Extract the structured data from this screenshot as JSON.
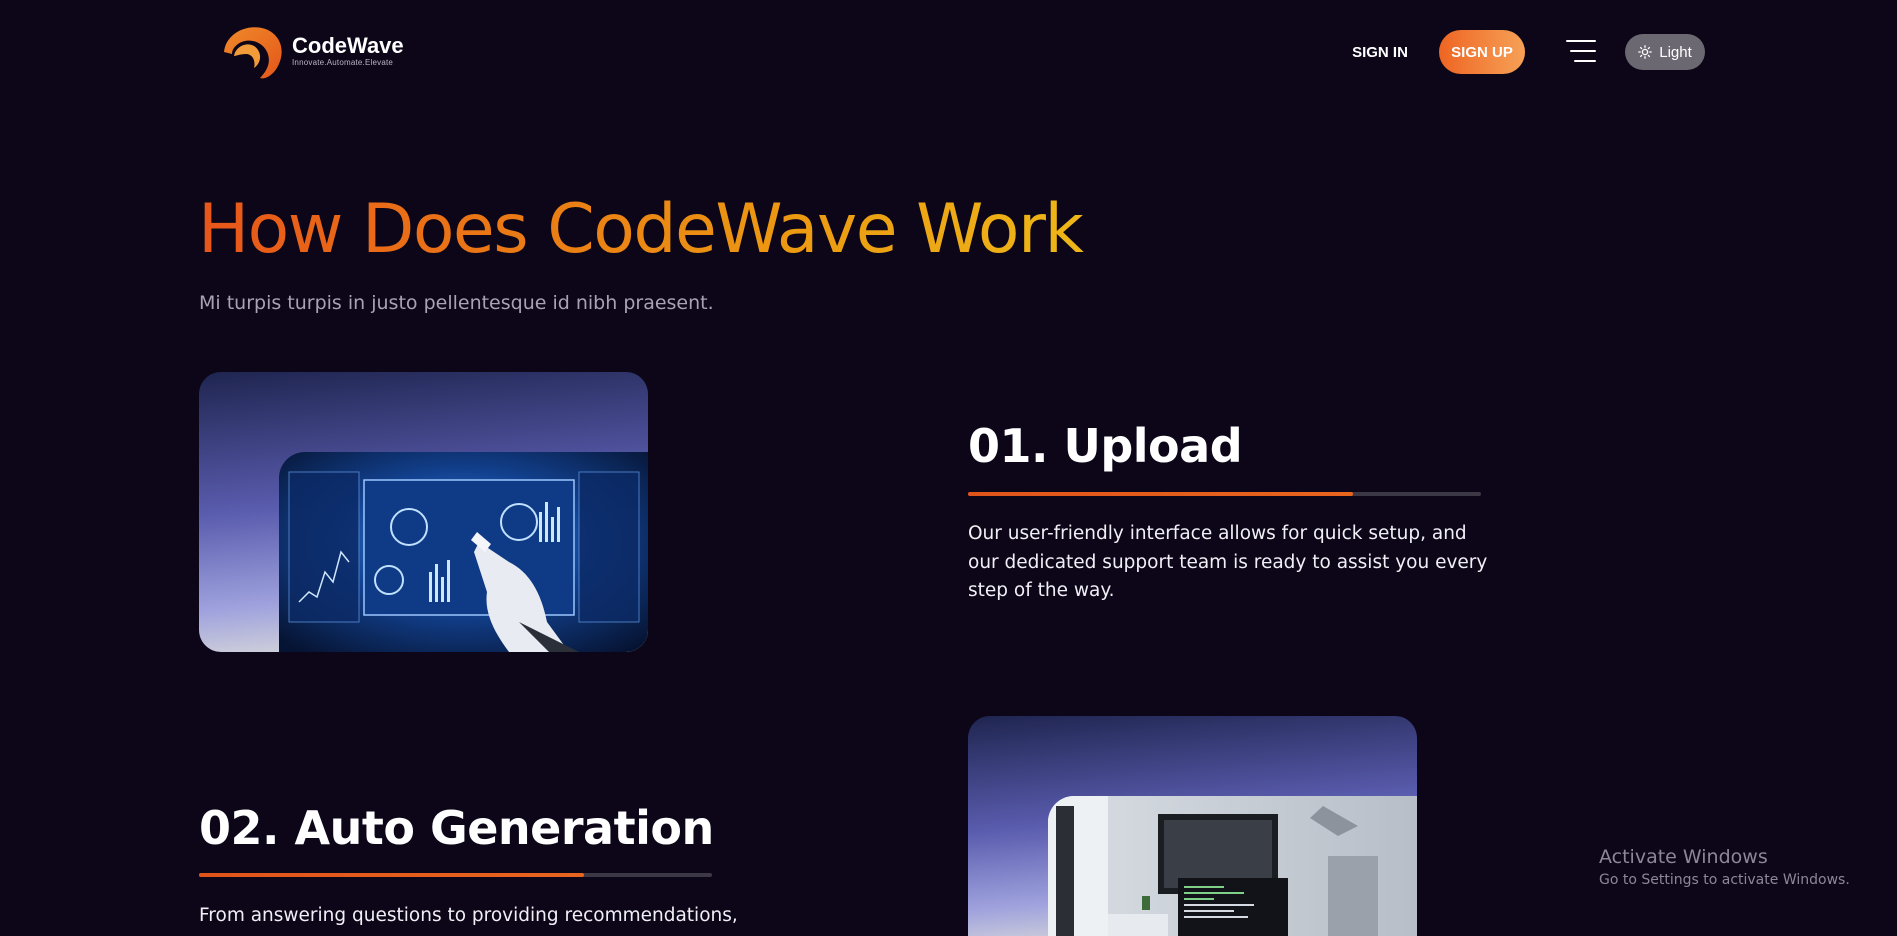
{
  "brand": {
    "name": "CodeWave",
    "tagline": "Innovate.Automate.Elevate"
  },
  "nav": {
    "sign_in": "SIGN IN",
    "sign_up": "SIGN UP",
    "menu_icon": "hamburger-menu-icon",
    "theme_toggle_label": "Light",
    "theme_toggle_icon": "sun-icon"
  },
  "hero": {
    "title": "How Does CodeWave Work",
    "subtitle": "Mi turpis turpis in justo pellentesque id nibh praesent."
  },
  "steps": [
    {
      "title": "01. Upload",
      "text": "Our user-friendly interface allows for quick setup, and our dedicated support team is ready to assist you every step of the way.",
      "progress_percent": 75
    },
    {
      "title": "02. Auto Generation",
      "text": "From answering questions to providing recommendations,",
      "progress_percent": 75
    }
  ],
  "watermark": {
    "title": "Activate Windows",
    "subtitle": "Go to Settings to activate Windows."
  },
  "colors": {
    "background": "#0d0618",
    "accent_orange": "#ee6523",
    "title_gradient_start": "#e8561a",
    "title_gradient_end": "#efc21a",
    "toggle_bg": "#6b6872"
  }
}
